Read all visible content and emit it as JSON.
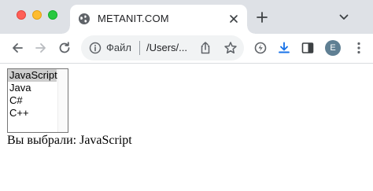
{
  "window": {
    "colors": {
      "close": "#ff5f57",
      "minimize": "#febc2e",
      "maximize": "#28c840"
    }
  },
  "tab": {
    "title": "METANIT.COM",
    "favicon": "globe-icon",
    "close_icon": "close-icon"
  },
  "toolbar": {
    "back_icon": "arrow-left-icon",
    "forward_icon": "arrow-right-icon",
    "reload_icon": "reload-icon",
    "address": {
      "info_icon": "info-icon",
      "scheme_label": "Файл",
      "url": "/Users/...",
      "share_icon": "share-icon",
      "bookmark_icon": "star-icon"
    },
    "extensions": [
      "extension-icon",
      "download-icon",
      "sidepanel-icon"
    ],
    "accent_color": "#1a73e8",
    "profile_initial": "E",
    "menu_icon": "kebab-menu-icon"
  },
  "page": {
    "select": {
      "options": [
        "JavaScript",
        "Java",
        "C#",
        "C++"
      ],
      "selected_index": 0
    },
    "result_text": "Вы выбрали: JavaScript"
  }
}
